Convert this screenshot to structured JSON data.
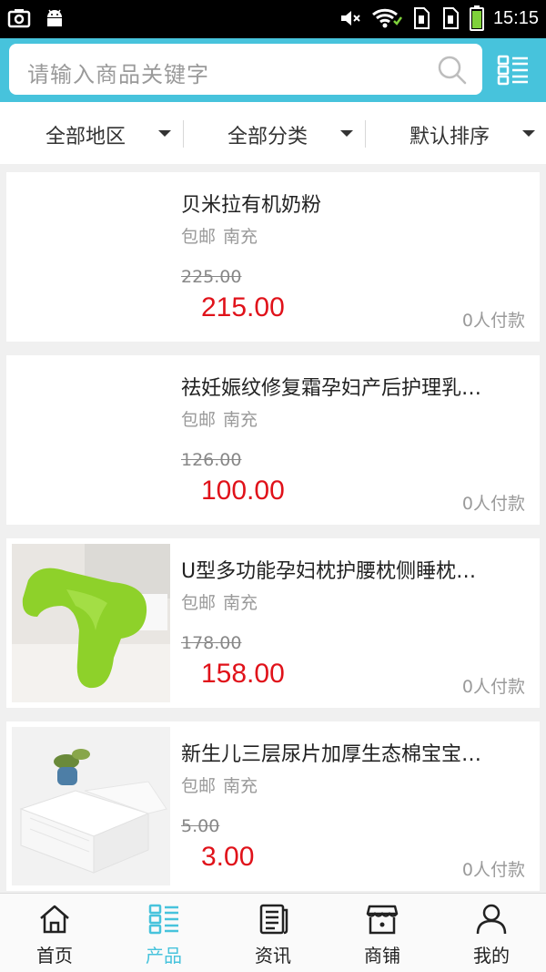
{
  "status_bar": {
    "time": "15:15"
  },
  "search": {
    "placeholder": "请输入商品关键字"
  },
  "filters": [
    {
      "label": "全部地区"
    },
    {
      "label": "全部分类"
    },
    {
      "label": "默认排序"
    }
  ],
  "products": [
    {
      "title": "贝米拉有机奶粉",
      "shipping": "包邮",
      "city": "南充",
      "original_price": "225.00",
      "price": "215.00",
      "paid": "0人付款",
      "image": "none"
    },
    {
      "title": "祛妊娠纹修复霜孕妇产后护理乳…",
      "shipping": "包邮",
      "city": "南充",
      "original_price": "126.00",
      "price": "100.00",
      "paid": "0人付款",
      "image": "none"
    },
    {
      "title": "U型多功能孕妇枕护腰枕侧睡枕…",
      "shipping": "包邮",
      "city": "南充",
      "original_price": "178.00",
      "price": "158.00",
      "paid": "0人付款",
      "image": "green-u-pillow"
    },
    {
      "title": "新生儿三层尿片加厚生态棉宝宝…",
      "shipping": "包邮",
      "city": "南充",
      "original_price": "5.00",
      "price": "3.00",
      "paid": "0人付款",
      "image": "white-diapers"
    }
  ],
  "bottom_nav": [
    {
      "label": "首页",
      "icon": "home-icon"
    },
    {
      "label": "产品",
      "icon": "product-grid-icon",
      "active": true
    },
    {
      "label": "资讯",
      "icon": "news-icon"
    },
    {
      "label": "商铺",
      "icon": "shop-icon"
    },
    {
      "label": "我的",
      "icon": "user-icon"
    }
  ],
  "colors": {
    "accent": "#47c3dc",
    "price": "#e0121a",
    "battery": "#7fd13b"
  }
}
